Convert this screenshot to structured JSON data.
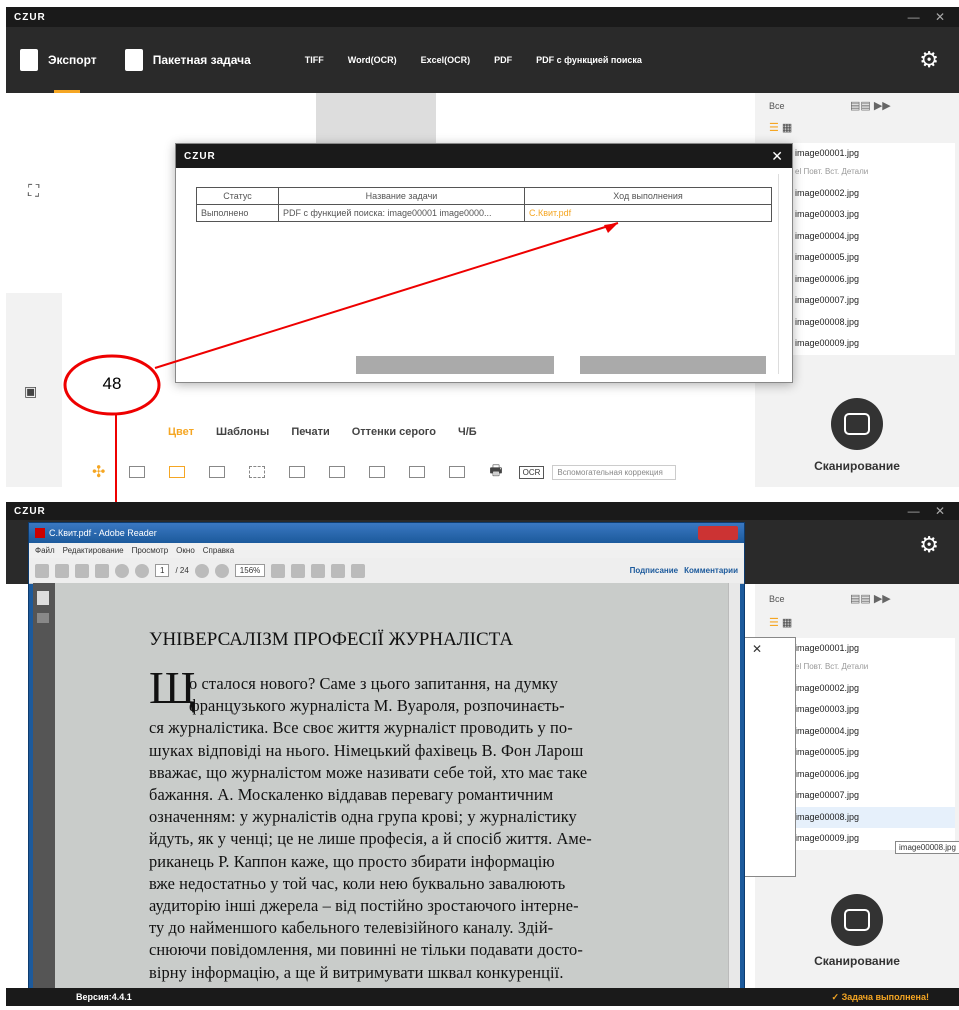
{
  "top": {
    "app_title": "CZUR",
    "window_controls": "— ✕",
    "export": "Экспорт",
    "batch": "Пакетная задача",
    "formats": [
      "TIFF",
      "Word(OCR)",
      "Excel(OCR)",
      "PDF",
      "PDF с функцией поиска"
    ],
    "select_all": "Все",
    "detail_tabs": "el  Повт.  Вст.  Детали",
    "files": [
      "image00001.jpg",
      "image00002.jpg",
      "image00003.jpg",
      "image00004.jpg",
      "image00005.jpg",
      "image00006.jpg",
      "image00007.jpg",
      "image00008.jpg",
      "image00009.jpg"
    ],
    "scan": "Сканирование",
    "tabs": [
      "Цвет",
      "Шаблоны",
      "Печати",
      "Оттенки серого",
      "Ч/Б"
    ],
    "ocr": "OCR",
    "assist": "Вспомогательная коррекция"
  },
  "dialog": {
    "title": "CZUR",
    "close": "✕",
    "headers": [
      "Статус",
      "Название задачи",
      "Ход выполнения"
    ],
    "row": {
      "status": "Выполнено",
      "name": "PDF с функцией поиска: image00001 image0000...",
      "progress": "С.Квит.pdf"
    }
  },
  "callout": {
    "number": "48"
  },
  "bottom": {
    "app_title": "CZUR",
    "window_controls": "— ✕",
    "reader_title": "С.Квит.pdf - Adobe Reader",
    "menu": [
      "Файл",
      "Редактирование",
      "Просмотр",
      "Окно",
      "Справка"
    ],
    "page": "1",
    "pages": "/ 24",
    "zoom": "156%",
    "sign": "Подписание",
    "comments": "Комментарии",
    "select_all": "Все",
    "detail_tabs": "el  Повт.  Вст.  Детали",
    "files": [
      "image00001.jpg",
      "image00002.jpg",
      "image00003.jpg",
      "image00004.jpg",
      "image00005.jpg",
      "image00006.jpg",
      "image00007.jpg",
      "image00008.jpg",
      "image00009.jpg"
    ],
    "tooltip": "image00008.jpg",
    "scan": "Сканирование",
    "version": "Версия:4.4.1",
    "done": "Задача выполнена!"
  },
  "pdf": {
    "heading": "УНІВЕРСАЛІЗМ ПРОФЕСІЇ ЖУРНАЛІСТА",
    "dropcap": "Щ",
    "lines": [
      "о сталося нового? Саме з цього запитання, на думку",
      "французького журналіста М. Вуароля, розпочинаєть-",
      "ся журналістика. Все своє життя журналіст проводить у по-",
      "шуках відповіді на нього. Німецький фахівець В. Фон Ларош",
      "вважає, що журналістом може називати себе той, хто має таке",
      "бажання. А. Москаленко віддавав перевагу романтичним",
      "означенням: у журналістів одна група крові; у журналістику",
      "йдуть, як у ченці; це не лише професія, а й спосіб життя. Аме-",
      "риканець Р. Каппон каже, що просто збирати інформацію",
      "вже недостатньо у той час, коли нею буквально завалюють",
      "аудиторію інші джерела – від постійно зростаючого інтерне-",
      "ту до найменшого кабельного телевізійного каналу. Здій-",
      "снюючи повідомлення, ми повинні не тільки подавати досто-",
      "вірну інформацію, а ще й витримувати шквал конкуренції."
    ]
  }
}
